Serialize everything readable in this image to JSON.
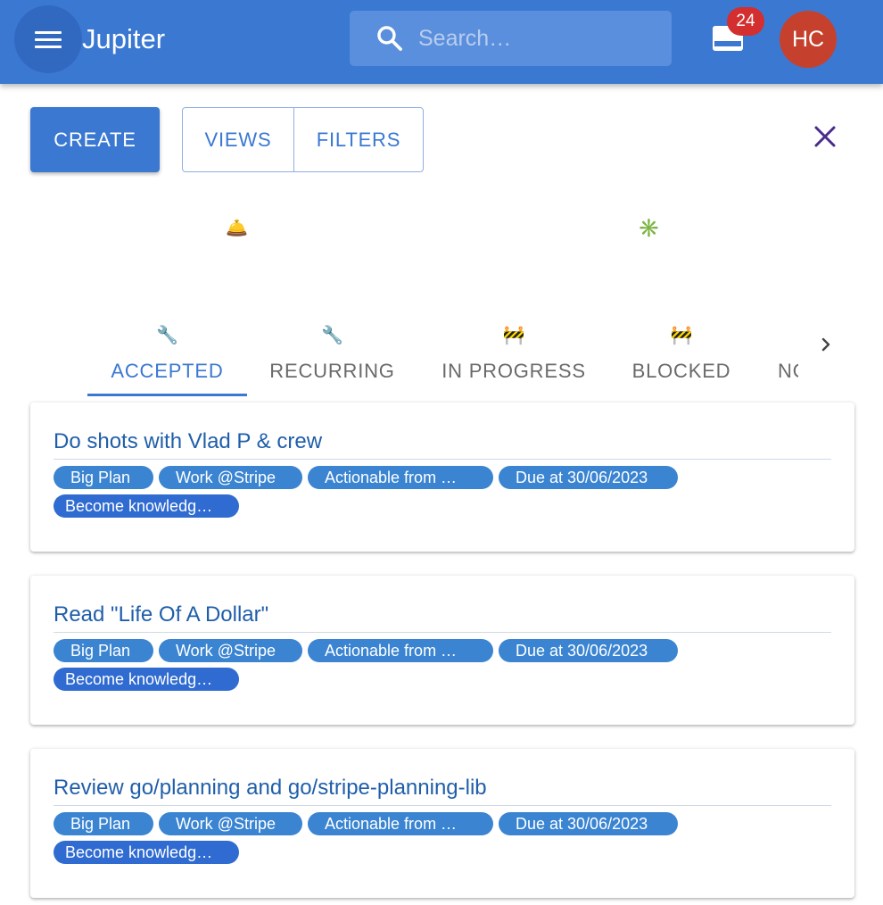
{
  "app": {
    "title": "Jupiter",
    "search_placeholder": "Search…",
    "inbox_count": "24",
    "user_initials": "HC",
    "colors": {
      "primary": "#3a78d2",
      "badge": "#d32f2f",
      "avatar": "#c6412d",
      "chip": "#3a84d1"
    }
  },
  "toolbar": {
    "create_label": "CREATE",
    "views_label": "VIEWS",
    "filters_label": "FILTERS",
    "close_icon": "close-icon"
  },
  "indicators": {
    "left_icon": "🛎️",
    "right_icon": "✳️"
  },
  "tabs": [
    {
      "icon": "🔧",
      "label": "ACCEPTED",
      "active": true
    },
    {
      "icon": "🔧",
      "label": "RECURRING",
      "active": false
    },
    {
      "icon": "🚧",
      "label": "IN PROGRESS",
      "active": false
    },
    {
      "icon": "🚧",
      "label": "BLOCKED",
      "active": false
    },
    {
      "icon": "",
      "label": "NOT DONE",
      "active": false
    }
  ],
  "cards": [
    {
      "title": "Do shots with Vlad P & crew",
      "chips": [
        "Big Plan",
        "Work @Stripe",
        "Actionable from …",
        "Due at 30/06/2023",
        "Become knowledg…"
      ]
    },
    {
      "title": "Read \"Life Of A Dollar\"",
      "chips": [
        "Big Plan",
        "Work @Stripe",
        "Actionable from …",
        "Due at 30/06/2023",
        "Become knowledg…"
      ]
    },
    {
      "title": "Review go/planning and go/stripe-planning-lib",
      "chips": [
        "Big Plan",
        "Work @Stripe",
        "Actionable from …",
        "Due at 30/06/2023",
        "Become knowledg…"
      ]
    }
  ]
}
